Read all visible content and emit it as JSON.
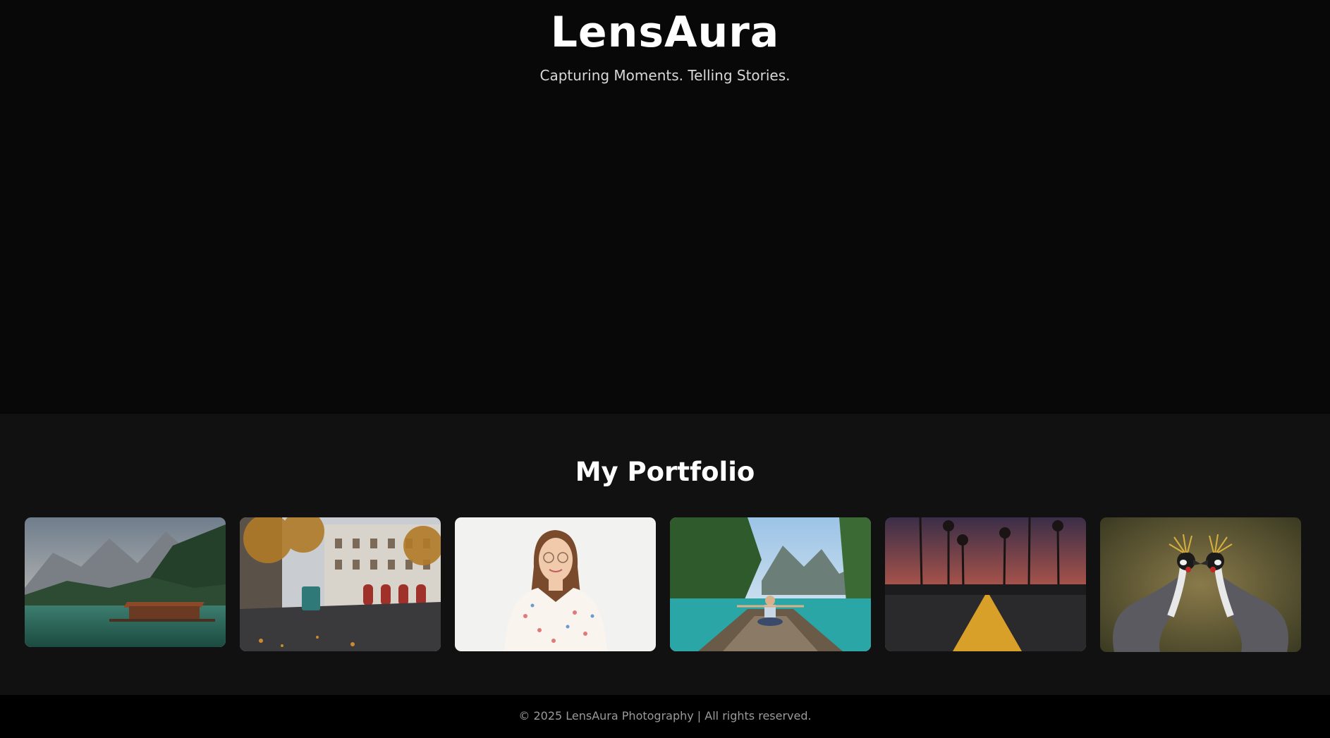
{
  "header": {
    "title": "LensAura",
    "tagline": "Capturing Moments. Telling Stories."
  },
  "portfolio": {
    "heading": "My Portfolio",
    "photos": [
      {
        "subject": "mountain lake with wooden boathouse"
      },
      {
        "subject": "autumn city street with tram"
      },
      {
        "subject": "portrait of woman with glasses"
      },
      {
        "subject": "woman sitting on boat in turquoise lagoon"
      },
      {
        "subject": "road at sunset with palm trees"
      },
      {
        "subject": "two crowned cranes"
      }
    ]
  },
  "footer": {
    "copyright": "© 2025 LensAura Photography | All rights reserved."
  },
  "colors": {
    "hero_bg": "#080808",
    "portfolio_bg": "#111111",
    "footer_bg": "#000000",
    "text_primary": "#ffffff",
    "text_muted": "#9a9a9a"
  }
}
